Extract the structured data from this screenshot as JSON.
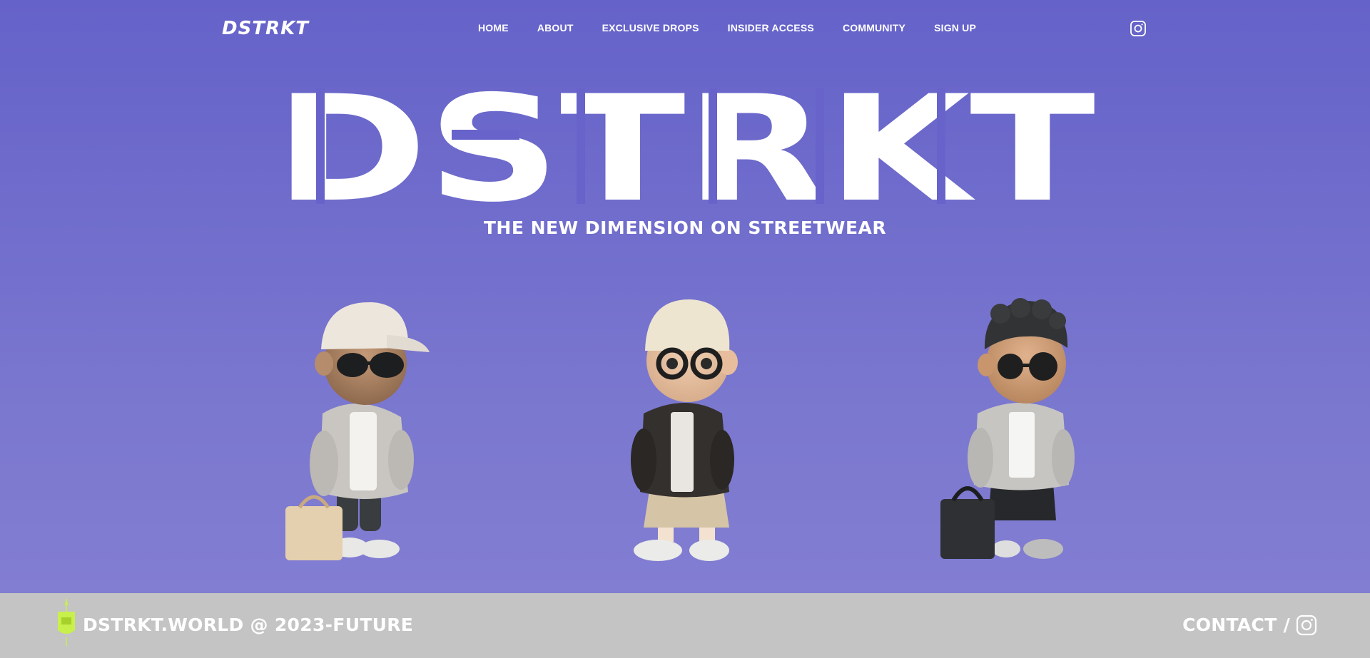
{
  "nav": {
    "logo": "DSTRKT",
    "links": [
      "HOME",
      "ABOUT",
      "EXCLUSIVE DROPS",
      "INSIDER ACCESS",
      "COMMUNITY",
      "SIGN UP"
    ],
    "social_icon": "instagram-icon"
  },
  "hero": {
    "title": "DSTRKT",
    "tagline": "THE NEW DIMENSION ON STREETWEAR"
  },
  "figures": [
    {
      "name": "figure-cap-sunglasses-tote"
    },
    {
      "name": "figure-cap-glasses-hoodie"
    },
    {
      "name": "figure-curly-hair-bag"
    }
  ],
  "footer": {
    "copyright": "DSTRKT.WORLD @ 2023-FUTURE",
    "contact": "CONTACT /",
    "badge_icon": "badge-icon",
    "social_icon": "instagram-icon"
  },
  "colors": {
    "background_top": "#6562c9",
    "background_bottom": "#8580d3",
    "footer": "#c4c4c4",
    "accent": "#c8f04a",
    "text": "#ffffff"
  }
}
